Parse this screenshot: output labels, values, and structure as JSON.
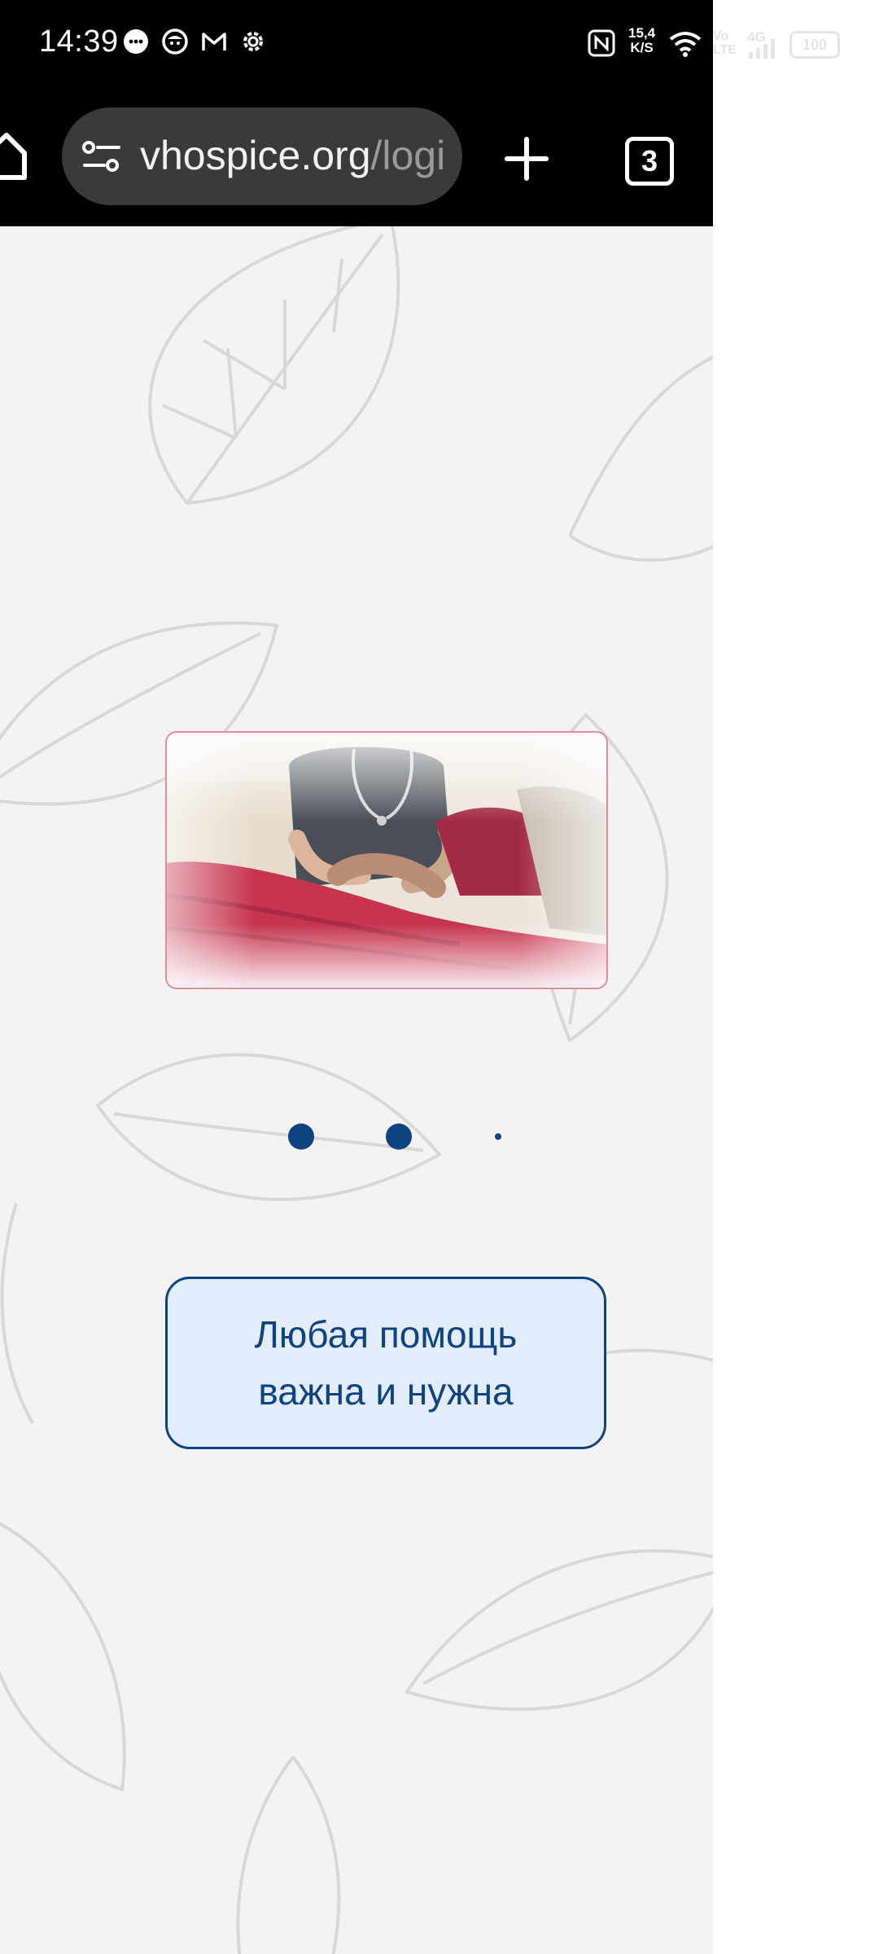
{
  "status_bar": {
    "time": "14:39",
    "network_speed_top": "15,4",
    "network_speed_bottom": "K/S",
    "volte_top": "Vo",
    "volte_bottom": "LTE",
    "network_type": "4G",
    "battery": "100",
    "notification_icons": [
      "message-icon",
      "face-app-icon",
      "gmail-icon",
      "settings-icon"
    ]
  },
  "browser": {
    "url_host": "vhospice.org",
    "url_path": "/logi",
    "tab_count": "3",
    "home_icon": "home-icon",
    "site_settings_icon": "site-settings-icon",
    "new_tab_icon": "plus-icon"
  },
  "page": {
    "carousel": {
      "image_alt": "caregiver holding patient's hand",
      "dots": [
        {
          "state": "inactive"
        },
        {
          "state": "inactive"
        },
        {
          "state": "active"
        }
      ]
    },
    "cta": {
      "line1": "Любая помощь",
      "line2": "важна и нужна"
    }
  },
  "colors": {
    "accent": "#0d4380",
    "button_bg": "#e2ecfa",
    "image_border": "#e58a98",
    "page_bg": "#f3f3f3"
  }
}
